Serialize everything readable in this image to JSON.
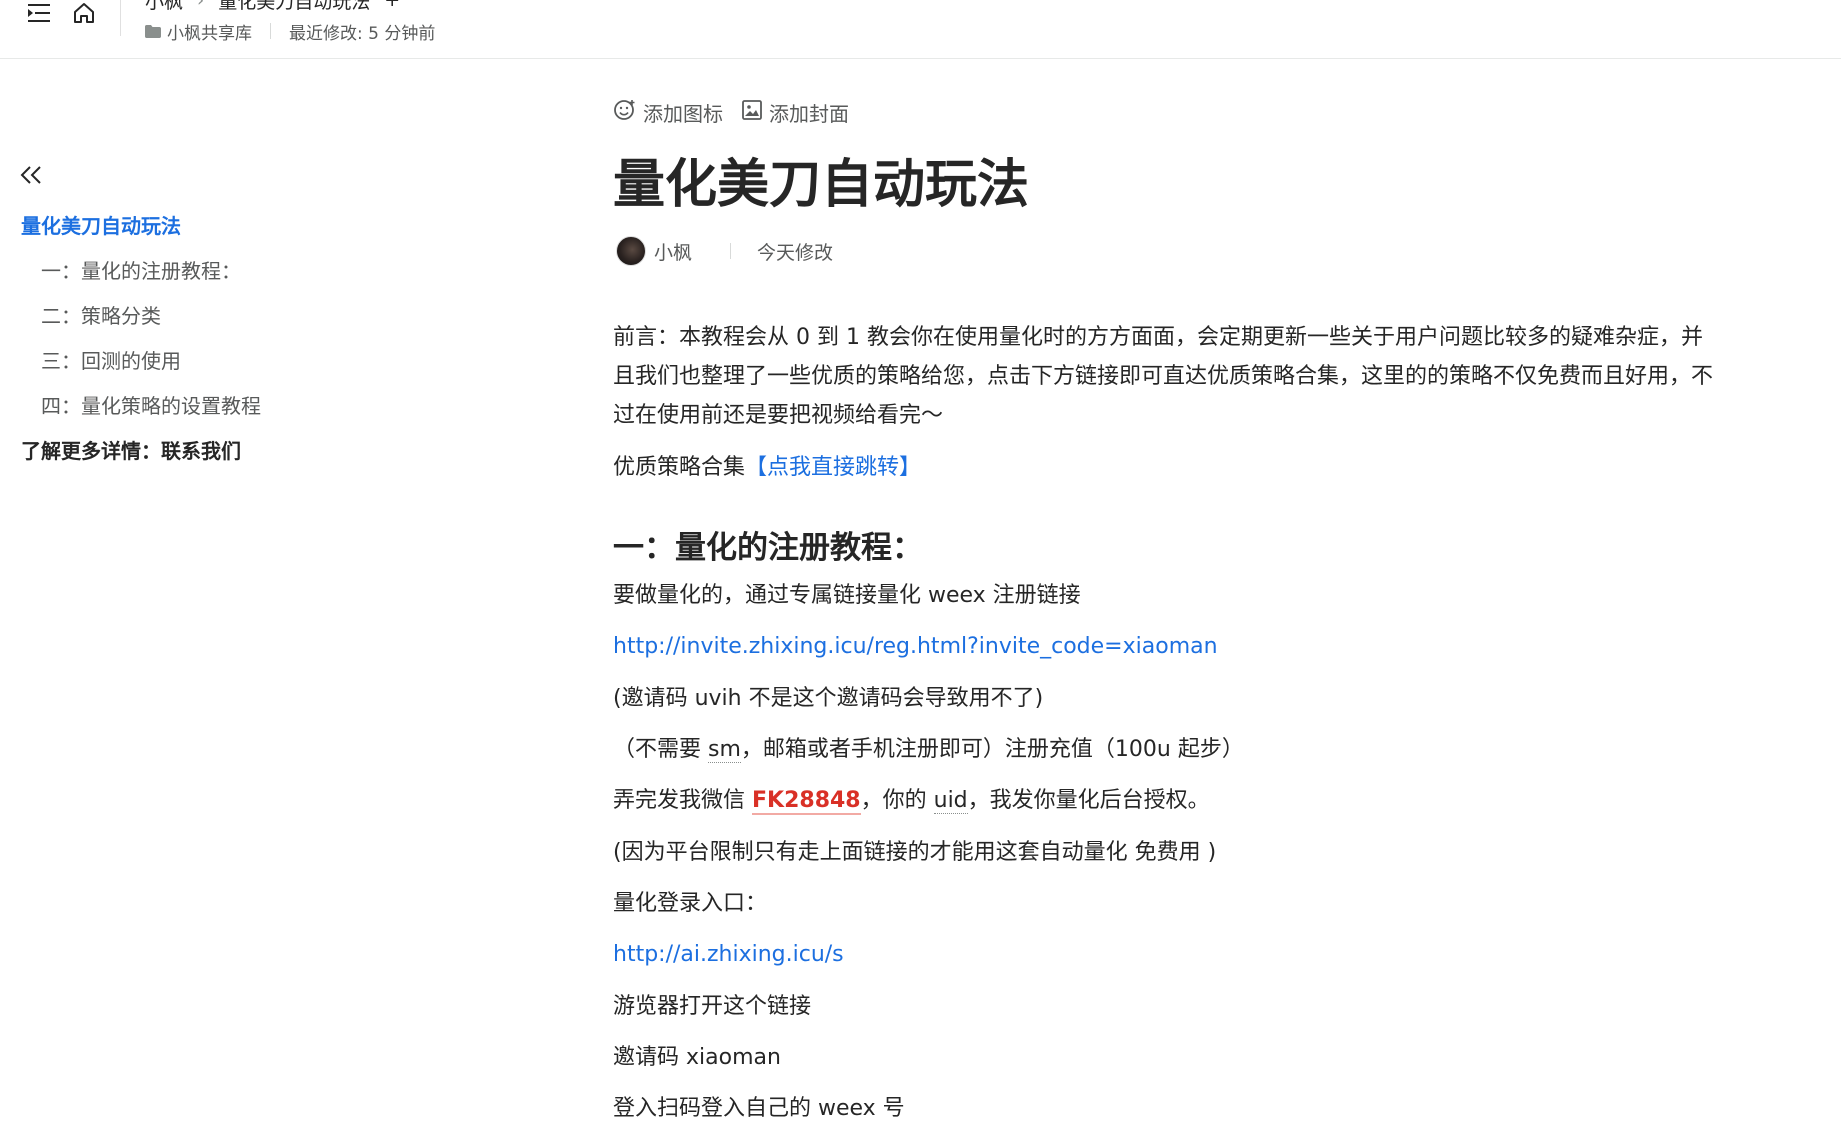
{
  "header": {
    "breadcrumb": [
      "小枫",
      "量化美刀自动玩法"
    ],
    "crumb_sep": "›",
    "crumb_extra": "+",
    "library": "小枫共享库",
    "last_modified": "最近修改: 5 分钟前"
  },
  "toc": {
    "items": [
      {
        "label": "量化美刀自动玩法",
        "level": 1,
        "active": true
      },
      {
        "label": "一：量化的注册教程：",
        "level": 2
      },
      {
        "label": "二：策略分类",
        "level": 2
      },
      {
        "label": "三：回测的使用",
        "level": 2
      },
      {
        "label": "四：量化策略的设置教程",
        "level": 2
      },
      {
        "label": "了解更多详情：联系我们",
        "level": 1
      }
    ]
  },
  "doc": {
    "add_icon": "添加图标",
    "add_cover": "添加封面",
    "title": "量化美刀自动玩法",
    "author": "小枫",
    "modified": "今天修改",
    "intro_line1": "前言：本教程会从 0 到 1 教会你在使用量化时的方方面面，会定期更新一些关于用户问题比较多的疑难杂症，并",
    "intro_line2": "且我们也整理了一些优质的策略给您，点击下方链接即可直达优质策略合集，这里的的策略不仅免费而且好用，不",
    "intro_line3": "过在使用前还是要把视频给看完～",
    "collection_prefix": "优质策略合集",
    "collection_link": "【点我直接跳转】",
    "section1_title": "一：量化的注册教程：",
    "p1": "要做量化的，通过专属链接量化 weex 注册链接",
    "reg_link": "http://invite.zhixing.icu/reg.html?invite_code=xiaoman",
    "p2": "(邀请码 uvih 不是这个邀请码会导致用不了)",
    "p3_a": "（不需要 ",
    "p3_b": "sm",
    "p3_c": "，邮箱或者手机注册即可）注册充值（100u 起步）",
    "p4_a": "弄完发我微信 ",
    "p4_wechat": "FK28848",
    "p4_b": "，你的 ",
    "p4_uid": "uid",
    "p4_c": "，我发你量化后台授权。",
    "p5": "(因为平台限制只有走上面链接的才能用这套自动量化 免费用 )",
    "p6": "量化登录入口：",
    "login_link": "http://ai.zhixing.icu/s",
    "p7": "游览器打开这个链接",
    "p8": "邀请码 xiaoman",
    "p9": "登入扫码登入自己的 weex 号"
  },
  "colors": {
    "accent": "#1c6fe0",
    "highlight_red": "#d93026",
    "text": "#262626",
    "muted": "#585a5a"
  },
  "icons": [
    "toc-toggle-icon",
    "home-icon",
    "folder-icon",
    "collapse-left-icon",
    "smile-icon",
    "image-icon"
  ]
}
